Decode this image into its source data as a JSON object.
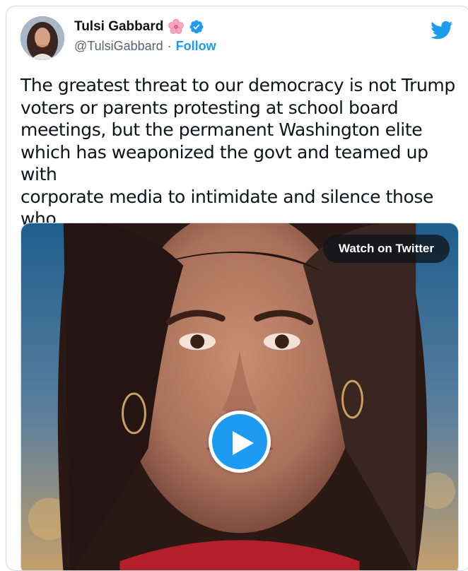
{
  "tweet": {
    "author": {
      "display_name": "Tulsi Gabbard",
      "name_emoji": "hibiscus-flower-icon",
      "verified": true,
      "handle": "@TulsiGabbard",
      "separator": "·",
      "follow_label": "Follow"
    },
    "brand_icon": "twitter-bird-icon",
    "text": "The greatest threat to our democracy is not Trump\nvoters or parents protesting at school board\nmeetings, but the permanent Washington elite\nwhich has weaponized the govt and teamed up with\ncorporate media to intimidate and silence those who\ndare to disagree with them.",
    "media": {
      "watch_label": "Watch on Twitter",
      "play_icon": "play-icon"
    }
  },
  "colors": {
    "accent": "#1d9bf0",
    "text": "#0f1419",
    "secondary_text": "#536471",
    "border": "#cfd9de"
  }
}
